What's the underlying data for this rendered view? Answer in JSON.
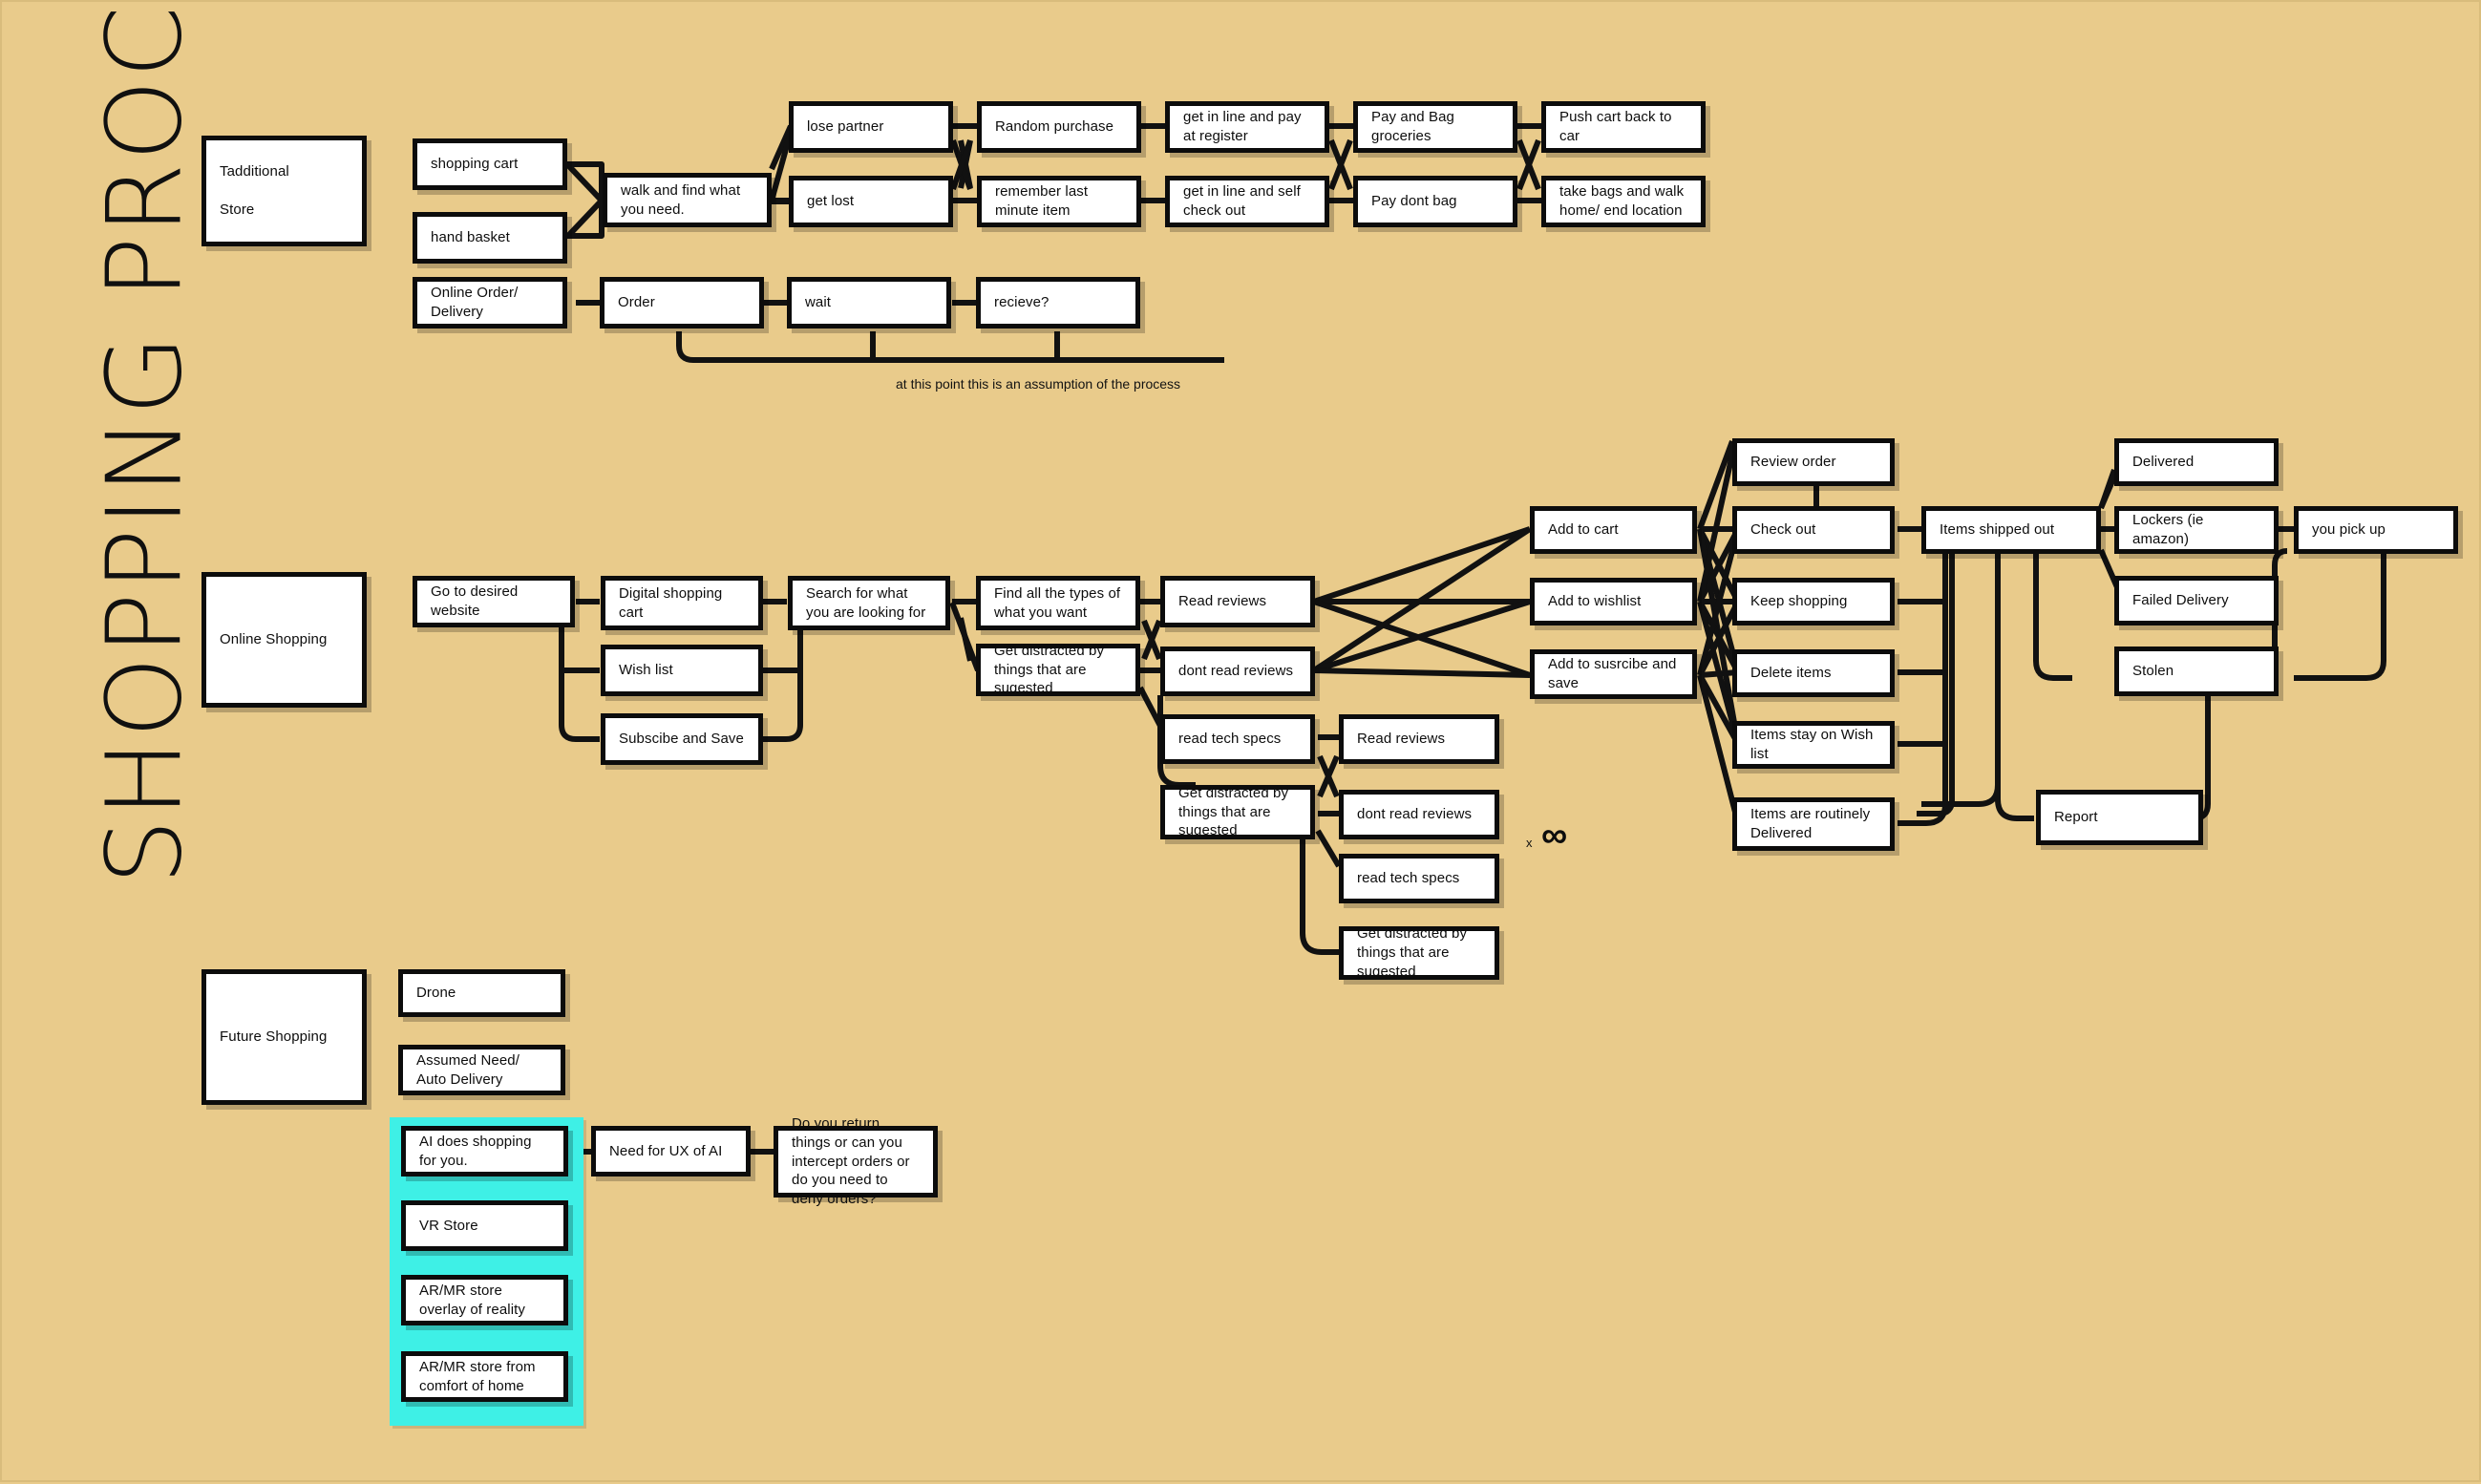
{
  "page": {
    "title": "SHOPPING PROCESS.",
    "background_color": "#e9cb8b",
    "box_fill": "#ffffff",
    "box_border_color": "#0c0c0c",
    "highlight_color": "#3ef0e6"
  },
  "lanes": [
    {
      "id": "lane-traditional",
      "label": "Tadditional\nStore"
    },
    {
      "id": "lane-online",
      "label": "Online Shopping"
    },
    {
      "id": "lane-future",
      "label": "Future Shopping"
    }
  ],
  "lane_labels": {
    "traditional_line1": "Tadditional",
    "traditional_line2": "Store",
    "online": "Online Shopping",
    "future": "Future Shopping"
  },
  "traditional": {
    "entry_modes": [
      "shopping cart",
      "hand basket"
    ],
    "online_entry": "Online Order/ Delivery",
    "walk_step": "walk and find what you need.",
    "branch_rows": [
      {
        "row": "top",
        "steps": [
          "lose partner",
          "Random purchase",
          "get in line and pay at register",
          "Pay and Bag groceries",
          "Push cart back to car"
        ]
      },
      {
        "row": "bottom",
        "steps": [
          "get lost",
          "remember last minute item",
          "get in line and self check out",
          "Pay dont bag",
          "take bags and walk home/ end location"
        ]
      }
    ],
    "delivery_steps": [
      "Order",
      "wait",
      "recieve?"
    ],
    "assumption_note": "at this point this is an assumption of the process"
  },
  "online": {
    "start": "Go to desired website",
    "cart_options": [
      "Digital shopping cart",
      "Wish list",
      "Subscibe and Save"
    ],
    "search": "Search for what you are looking for",
    "discovery": [
      "Find all the types of what you want",
      "Get distracted by things that are sugested"
    ],
    "review_primary": [
      "Read reviews",
      "dont read reviews"
    ],
    "review_secondary": [
      "read tech specs",
      "Get distracted by things that are sugested"
    ],
    "review_tertiary": [
      "Read reviews",
      "dont read reviews",
      "read tech specs",
      "Get distracted by things that are sugested"
    ],
    "loop_multiplier_x": "x",
    "loop_multiplier_symbol": "∞",
    "add_actions": [
      "Add to cart",
      "Add to wishlist",
      "Add to susrcibe and save"
    ],
    "review_order": "Review order",
    "outcomes": [
      "Check out",
      "Keep shopping",
      "Delete items",
      "Items stay on Wish list",
      "Items are routinely Delivered"
    ],
    "shipping": "Items shipped out",
    "delivery_results": [
      "Delivered",
      "Lockers (ie amazon)",
      "Failed Delivery",
      "Stolen"
    ],
    "pickup": "you pick up",
    "report": "Report"
  },
  "future": {
    "items": [
      "Drone",
      "Assumed Need/ Auto Delivery"
    ],
    "highlighted_items": [
      "AI does shopping for you.",
      "VR Store",
      "AR/MR store overlay of reality",
      "AR/MR store from comfort of home"
    ],
    "ux_need": "Need for UX of AI",
    "question": "Do you return things or can you intercept orders or do you need to deny orders?"
  }
}
